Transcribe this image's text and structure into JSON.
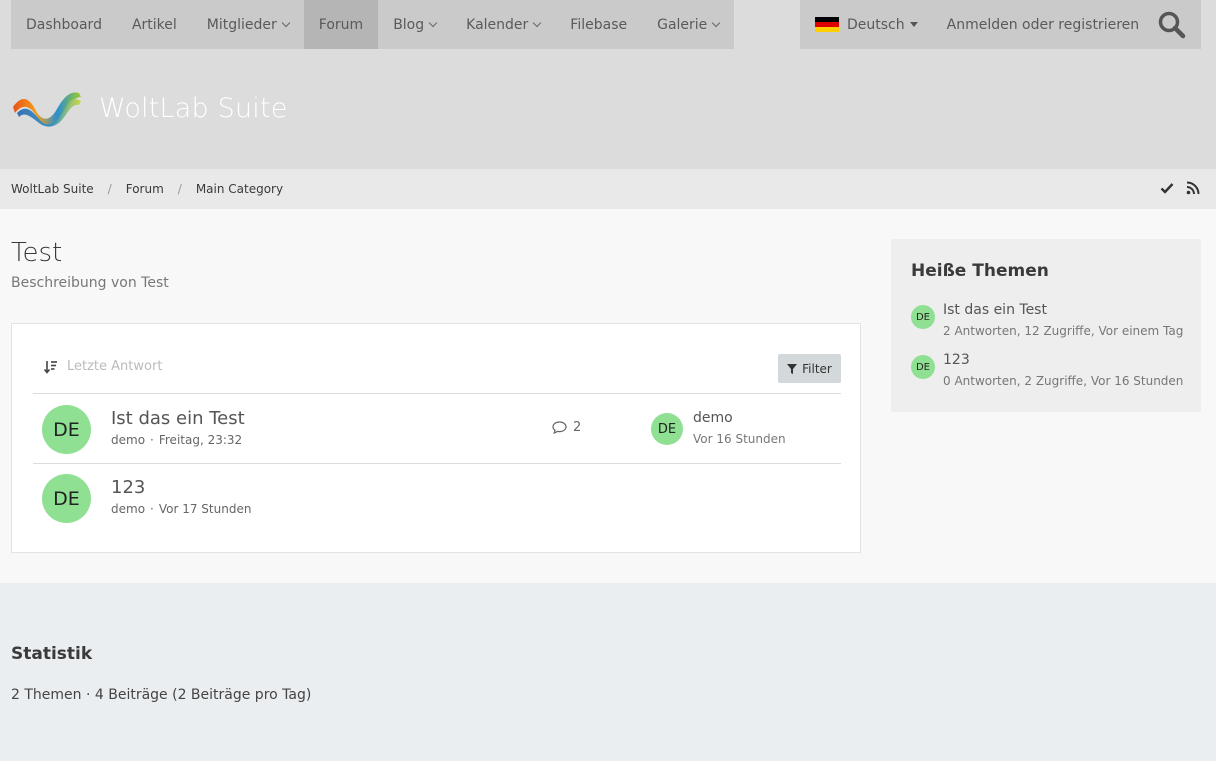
{
  "nav": {
    "items": [
      {
        "label": "Dashboard",
        "dropdown": false,
        "active": false
      },
      {
        "label": "Artikel",
        "dropdown": false,
        "active": false
      },
      {
        "label": "Mitglieder",
        "dropdown": true,
        "active": false
      },
      {
        "label": "Forum",
        "dropdown": false,
        "active": true
      },
      {
        "label": "Blog",
        "dropdown": true,
        "active": false
      },
      {
        "label": "Kalender",
        "dropdown": true,
        "active": false
      },
      {
        "label": "Filebase",
        "dropdown": false,
        "active": false
      },
      {
        "label": "Galerie",
        "dropdown": true,
        "active": false
      }
    ]
  },
  "usernav": {
    "language": "Deutsch",
    "login": "Anmelden oder registrieren"
  },
  "logo": {
    "text": "WoltLab Suite"
  },
  "breadcrumb": [
    "WoltLab Suite",
    "Forum",
    "Main Category"
  ],
  "page": {
    "title": "Test",
    "description": "Beschreibung von Test"
  },
  "threadlist": {
    "sort_label": "Letzte Antwort",
    "filter_label": "Filter",
    "threads": [
      {
        "avatar": "DE",
        "title": "Ist das ein Test",
        "author": "demo",
        "time": "Freitag, 23:32",
        "replies": "2",
        "last_avatar": "DE",
        "last_user": "demo",
        "last_time": "Vor 16 Stunden"
      },
      {
        "avatar": "DE",
        "title": "123",
        "author": "demo",
        "time": "Vor 17 Stunden"
      }
    ]
  },
  "sidebar": {
    "title": "Heiße Themen",
    "items": [
      {
        "avatar": "DE",
        "title": "Ist das ein Test",
        "meta": "2 Antworten, 12 Zugriffe, Vor einem Tag"
      },
      {
        "avatar": "DE",
        "title": "123",
        "meta": "0 Antworten, 2 Zugriffe, Vor 16 Stunden"
      }
    ]
  },
  "stats": {
    "title": "Statistik",
    "text": "2 Themen · 4 Beiträge (2 Beiträge pro Tag)"
  },
  "colors": {
    "avatar_bg": "#8fe093",
    "nav_bg": "#cacaca",
    "nav_active": "#b5b5b5",
    "header_bg": "#dcdcdc"
  }
}
